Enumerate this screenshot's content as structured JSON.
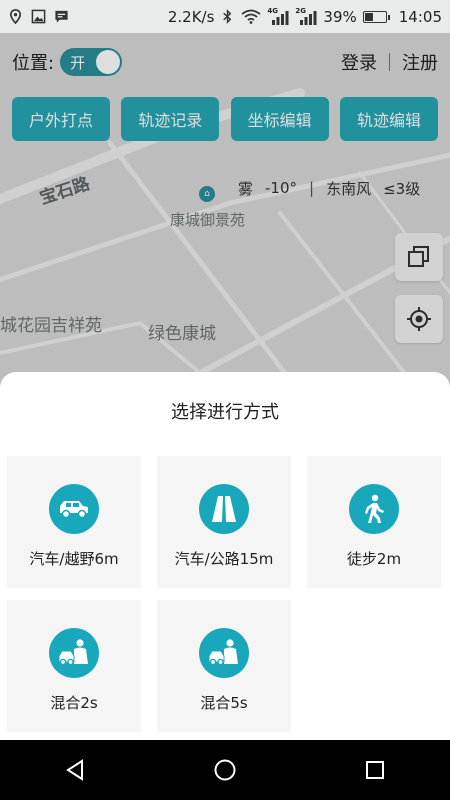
{
  "status_bar": {
    "network_speed": "2.2K/s",
    "battery_percent": "39%",
    "battery_level": 0.39,
    "time": "14:05",
    "net1": "4G",
    "net2": "2G"
  },
  "header": {
    "location_label": "位置:",
    "location_toggle": "开",
    "login": "登录",
    "register": "注册"
  },
  "toolbar": {
    "buttons": [
      "户外打点",
      "轨迹记录",
      "坐标编辑",
      "轨迹编辑"
    ]
  },
  "map": {
    "labels": {
      "road": "宝石路",
      "poi": "康城御景苑",
      "area_left": "城花园吉祥苑",
      "area_mid": "绿色康城"
    }
  },
  "weather": {
    "condition": "雾",
    "temperature": "-10°",
    "separator": "|",
    "wind_direction": "东南风",
    "wind_level": "≤3级"
  },
  "sheet": {
    "title": "选择进行方式",
    "modes": [
      {
        "label": "汽车/越野6m",
        "icon": "suv-icon"
      },
      {
        "label": "汽车/公路15m",
        "icon": "road-icon"
      },
      {
        "label": "徒步2m",
        "icon": "walking-icon"
      },
      {
        "label": "混合2s",
        "icon": "mixed-icon"
      },
      {
        "label": "混合5s",
        "icon": "mixed-icon"
      }
    ]
  },
  "colors": {
    "accent": "#27a7b5",
    "toggle": "#2a8f9b",
    "mode_icon": "#19a8bb"
  }
}
